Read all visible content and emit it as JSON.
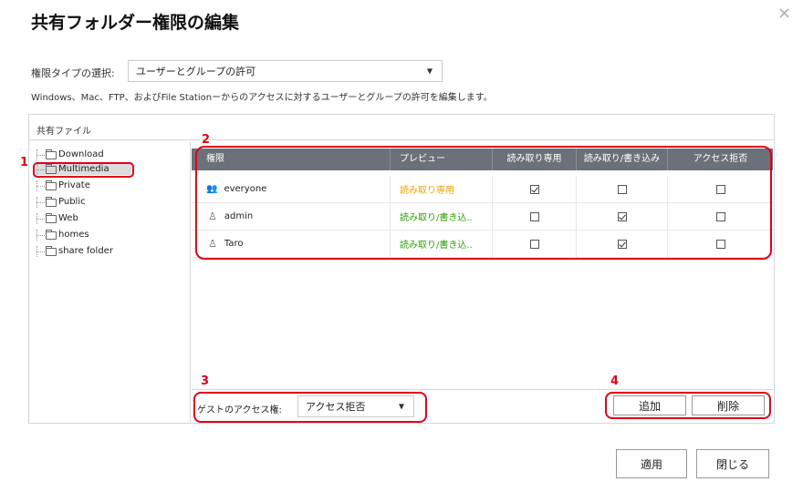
{
  "dialog": {
    "title": "共有フォルダー権限の編集",
    "close_glyph": "×"
  },
  "permission_type": {
    "label": "権限タイプの選択:",
    "value": "ユーザーとグループの許可",
    "description": "Windows、Mac、FTP、およびFile Stationーからのアクセスに対するユーザーとグループの許可を編集します。"
  },
  "shared_files": {
    "header": "共有ファイル",
    "folders": [
      {
        "label": "Download",
        "selected": false
      },
      {
        "label": "Multimedia",
        "selected": true
      },
      {
        "label": "Private",
        "selected": false
      },
      {
        "label": "Public",
        "selected": false
      },
      {
        "label": "Web",
        "selected": false
      },
      {
        "label": "homes",
        "selected": false
      },
      {
        "label": "share folder",
        "selected": false
      }
    ]
  },
  "table": {
    "columns": [
      "権限",
      "プレビュー",
      "読み取り専用",
      "読み取り/書き込み",
      "アクセス拒否"
    ],
    "rows": [
      {
        "name": "everyone",
        "icon": "group-icon",
        "preview": "読み取り専用",
        "preview_color": "#f0a000",
        "read_only": true,
        "read_write": false,
        "deny": false
      },
      {
        "name": "admin",
        "icon": "user-icon",
        "preview": "読み取り/書き込..",
        "preview_color": "#2ea000",
        "read_only": false,
        "read_write": true,
        "deny": false
      },
      {
        "name": "Taro",
        "icon": "user-icon",
        "preview": "読み取り/書き込..",
        "preview_color": "#2ea000",
        "read_only": false,
        "read_write": true,
        "deny": false
      }
    ]
  },
  "guest": {
    "label": "ゲストのアクセス権:",
    "value": "アクセス拒否"
  },
  "buttons": {
    "add": "追加",
    "delete": "削除",
    "apply": "適用",
    "close": "閉じる"
  },
  "annotations": {
    "n1": "1",
    "n2": "2",
    "n3": "3",
    "n4": "4",
    "color": "#e2001a"
  }
}
